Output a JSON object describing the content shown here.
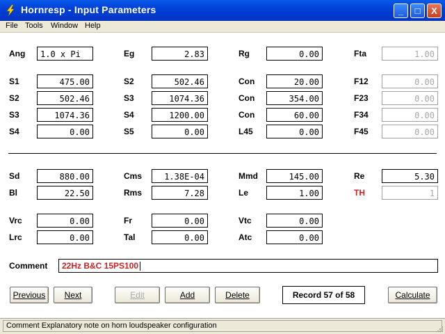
{
  "window": {
    "title": "Hornresp - Input Parameters",
    "controls": {
      "minimize": "_",
      "maximize": "□",
      "close": "X"
    }
  },
  "menu": [
    "File",
    "Tools",
    "Window",
    "Help"
  ],
  "horn": {
    "col1": [
      {
        "label": "Ang",
        "value": "1.0 x Pi"
      },
      {
        "label": "S1",
        "value": "475.00"
      },
      {
        "label": "S2",
        "value": "502.46"
      },
      {
        "label": "S3",
        "value": "1074.36"
      },
      {
        "label": "S4",
        "value": "0.00"
      }
    ],
    "col2": [
      {
        "label": "Eg",
        "value": "2.83"
      },
      {
        "label": "S2",
        "value": "502.46"
      },
      {
        "label": "S3",
        "value": "1074.36"
      },
      {
        "label": "S4",
        "value": "1200.00"
      },
      {
        "label": "S5",
        "value": "0.00"
      }
    ],
    "col3": [
      {
        "label": "Rg",
        "value": "0.00"
      },
      {
        "label": "Con",
        "value": "20.00"
      },
      {
        "label": "Con",
        "value": "354.00"
      },
      {
        "label": "Con",
        "value": "60.00"
      },
      {
        "label": "L45",
        "value": "0.00"
      }
    ],
    "col4": [
      {
        "label": "Fta",
        "value": "1.00"
      },
      {
        "label": "F12",
        "value": "0.00"
      },
      {
        "label": "F23",
        "value": "0.00"
      },
      {
        "label": "F34",
        "value": "0.00"
      },
      {
        "label": "F45",
        "value": "0.00"
      }
    ]
  },
  "driver": {
    "col1": [
      {
        "label": "Sd",
        "value": "880.00"
      },
      {
        "label": "Bl",
        "value": "22.50"
      },
      {
        "label": "Vrc",
        "value": "0.00"
      },
      {
        "label": "Lrc",
        "value": "0.00"
      }
    ],
    "col2": [
      {
        "label": "Cms",
        "value": "1.38E-04"
      },
      {
        "label": "Rms",
        "value": "7.28"
      },
      {
        "label": "Fr",
        "value": "0.00"
      },
      {
        "label": "Tal",
        "value": "0.00"
      }
    ],
    "col3": [
      {
        "label": "Mmd",
        "value": "145.00"
      },
      {
        "label": "Le",
        "value": "1.00"
      },
      {
        "label": "Vtc",
        "value": "0.00"
      },
      {
        "label": "Atc",
        "value": "0.00"
      }
    ],
    "col4": [
      {
        "label": "Re",
        "value": "5.30"
      },
      {
        "label": "TH",
        "value": "1"
      }
    ]
  },
  "comment": {
    "label": "Comment",
    "value": "22Hz B&C 15PS100"
  },
  "buttons": {
    "previous": "Previous",
    "next": "Next",
    "edit": "Edit",
    "add": "Add",
    "delete": "Delete",
    "record": "Record 57 of 58",
    "calculate": "Calculate"
  },
  "status": "Comment   Explanatory note on horn loudspeaker configuration",
  "colors": {
    "titlebar": "#0040d8",
    "comment_text": "#c82020",
    "th_label": "#d42020"
  }
}
